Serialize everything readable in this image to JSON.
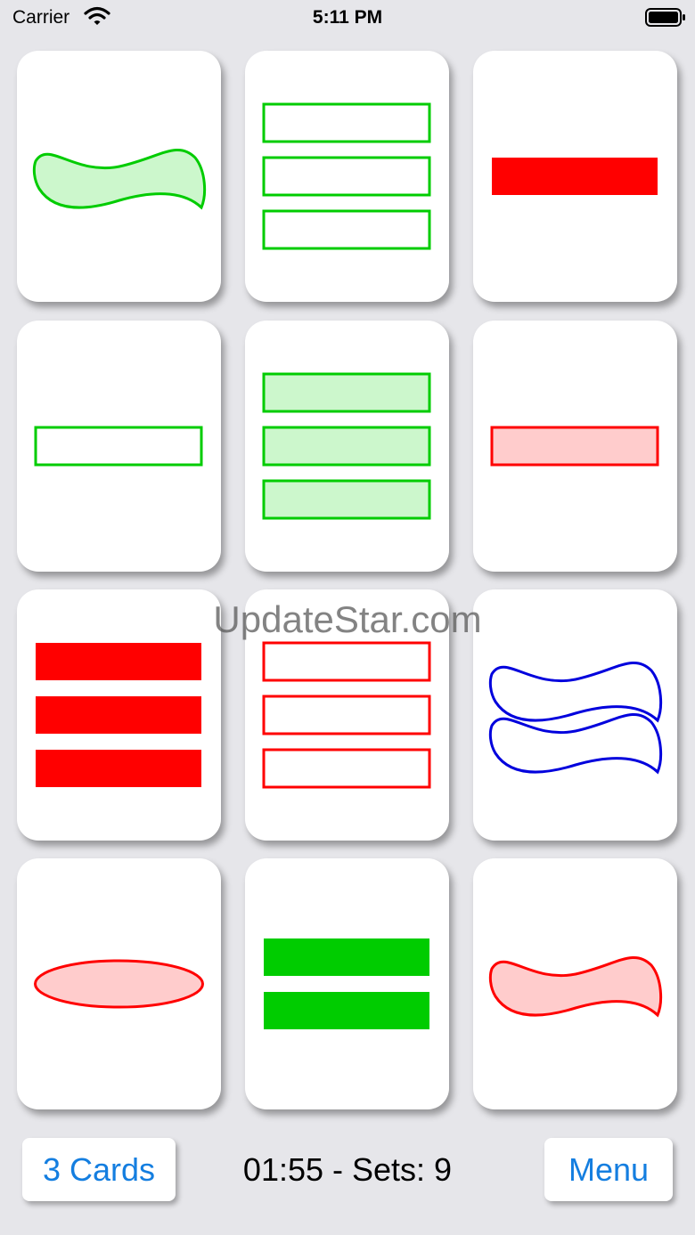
{
  "status_bar": {
    "carrier": "Carrier",
    "time": "5:11 PM"
  },
  "colors": {
    "green": "#00cc00",
    "red": "#ff0000",
    "blue": "#0000dd",
    "button_text": "#147ee0",
    "background": "#e6e6ea"
  },
  "cards": [
    {
      "count": 1,
      "shape": "squiggle",
      "fill": "striped",
      "color": "green"
    },
    {
      "count": 3,
      "shape": "rectangle",
      "fill": "empty",
      "color": "green"
    },
    {
      "count": 1,
      "shape": "rectangle",
      "fill": "solid",
      "color": "red"
    },
    {
      "count": 1,
      "shape": "rectangle",
      "fill": "empty",
      "color": "green"
    },
    {
      "count": 3,
      "shape": "rectangle",
      "fill": "striped",
      "color": "green"
    },
    {
      "count": 1,
      "shape": "rectangle",
      "fill": "striped",
      "color": "red"
    },
    {
      "count": 3,
      "shape": "rectangle",
      "fill": "solid",
      "color": "red"
    },
    {
      "count": 3,
      "shape": "rectangle",
      "fill": "empty",
      "color": "red"
    },
    {
      "count": 2,
      "shape": "squiggle",
      "fill": "empty",
      "color": "blue"
    },
    {
      "count": 1,
      "shape": "oval",
      "fill": "striped",
      "color": "red"
    },
    {
      "count": 2,
      "shape": "rectangle",
      "fill": "solid",
      "color": "green"
    },
    {
      "count": 1,
      "shape": "squiggle",
      "fill": "striped",
      "color": "red"
    }
  ],
  "watermark": "UpdateStar.com",
  "toolbar": {
    "cards_button": "3 Cards",
    "status": "01:55 - Sets: 9",
    "menu_button": "Menu"
  }
}
